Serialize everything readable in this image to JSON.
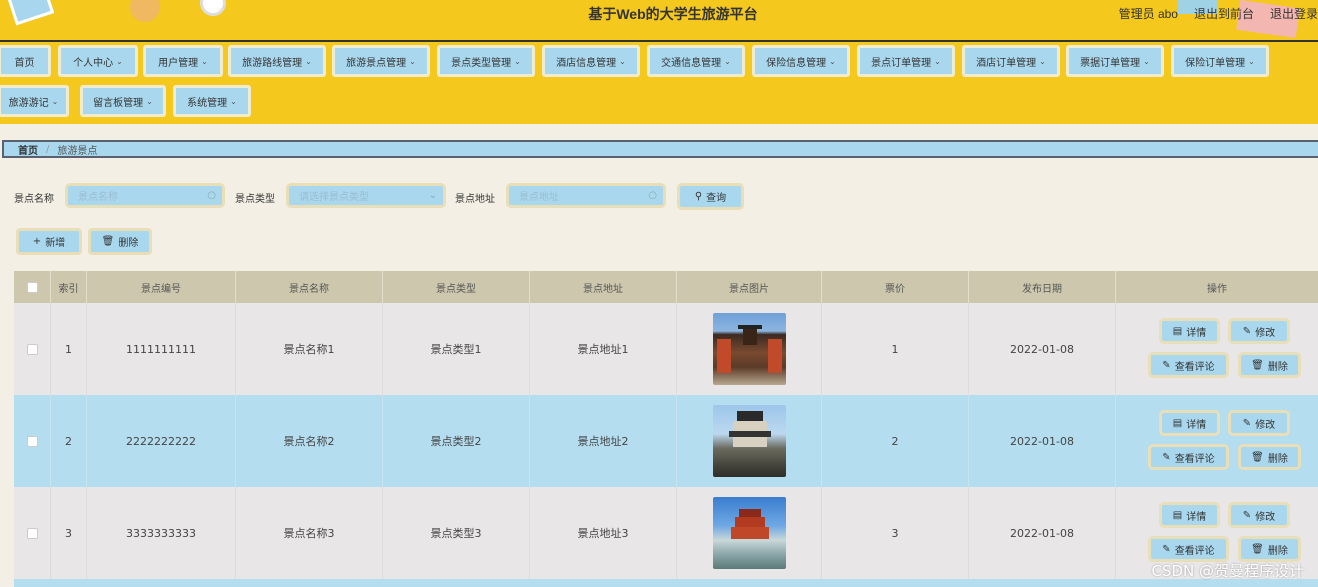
{
  "header": {
    "title": "基于Web的大学生旅游平台",
    "admin_label": "管理员 abo",
    "front_link": "退出到前台",
    "logout_link": "退出登录"
  },
  "nav": {
    "row1": [
      "首页",
      "个人中心",
      "用户管理",
      "旅游路线管理",
      "旅游景点管理",
      "景点类型管理",
      "酒店信息管理",
      "交通信息管理",
      "保险信息管理",
      "景点订单管理",
      "酒店订单管理",
      "票据订单管理",
      "保险订单管理"
    ],
    "row2": [
      "旅游游记",
      "留言板管理",
      "系统管理"
    ]
  },
  "breadcrumb": {
    "home": "首页",
    "current": "旅游景点"
  },
  "search": {
    "name_label": "景点名称",
    "name_placeholder": "景点名称",
    "type_label": "景点类型",
    "type_placeholder": "请选择景点类型",
    "address_label": "景点地址",
    "address_placeholder": "景点地址",
    "query_label": "查询"
  },
  "actions": {
    "add_label": "新增",
    "delete_label": "删除"
  },
  "table": {
    "columns": [
      "索引",
      "景点编号",
      "景点名称",
      "景点类型",
      "景点地址",
      "景点图片",
      "票价",
      "发布日期",
      "操作"
    ],
    "rows": [
      {
        "index": "1",
        "code": "1111111111",
        "name": "景点名称1",
        "type": "景点类型1",
        "address": "景点地址1",
        "price": "1",
        "date": "2022-01-08"
      },
      {
        "index": "2",
        "code": "2222222222",
        "name": "景点名称2",
        "type": "景点类型2",
        "address": "景点地址2",
        "price": "2",
        "date": "2022-01-08"
      },
      {
        "index": "3",
        "code": "3333333333",
        "name": "景点名称3",
        "type": "景点类型3",
        "address": "景点地址3",
        "price": "3",
        "date": "2022-01-08"
      }
    ],
    "ops": {
      "detail": "详情",
      "edit": "修改",
      "comments": "查看评论",
      "delete": "删除"
    }
  },
  "watermark": "CSDN @贺曼程序设计",
  "colors": {
    "header_bg": "#f5c81e",
    "button_bg": "#a9d8ee",
    "page_bg": "#f3efe4",
    "table_head": "#cdc8ad",
    "row_highlight": "#b5ddf0"
  }
}
